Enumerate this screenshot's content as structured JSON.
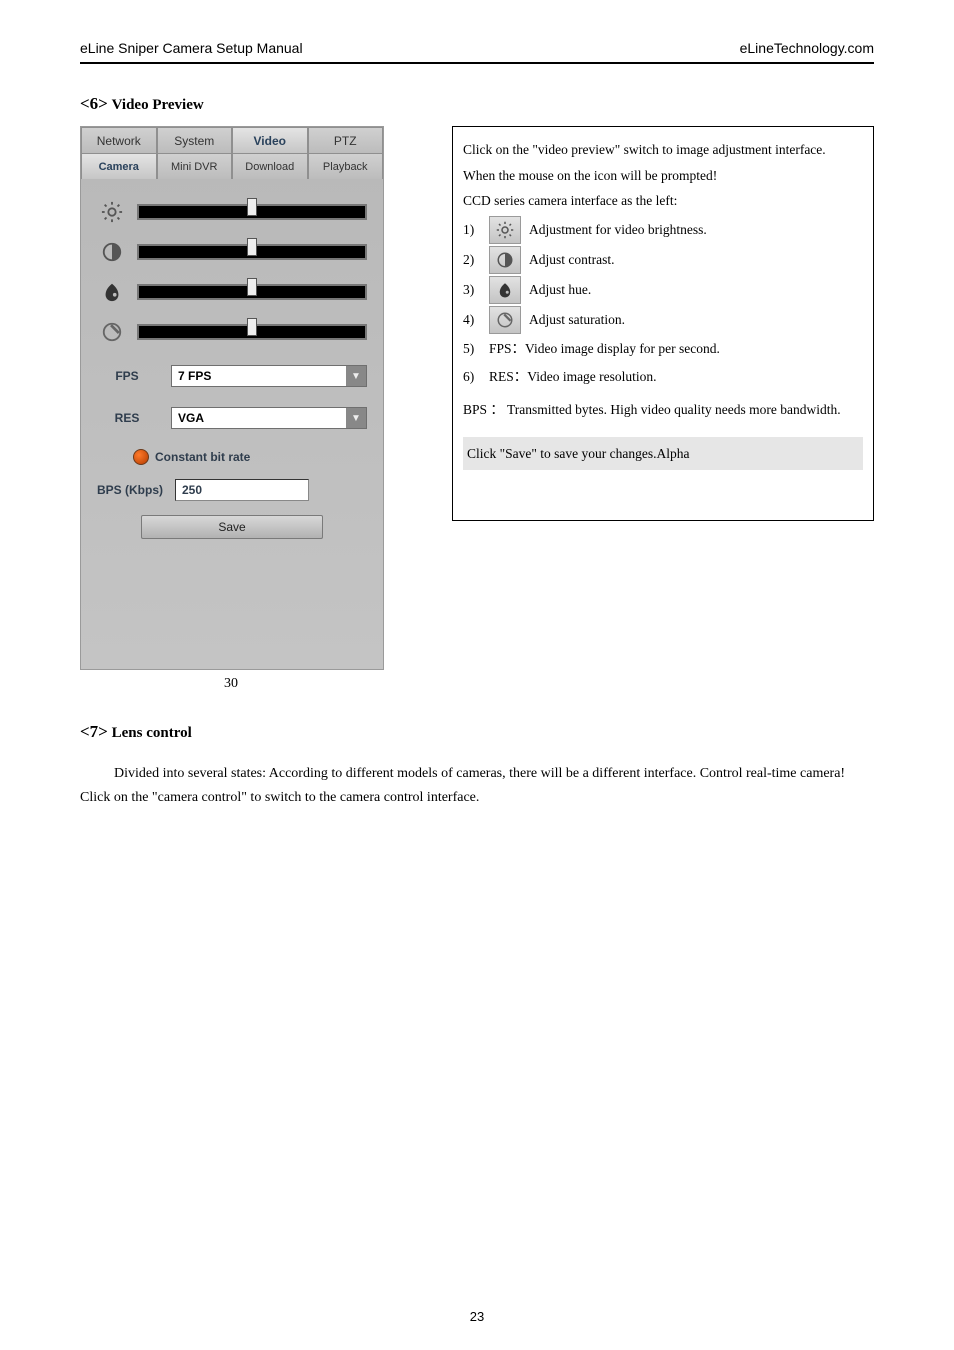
{
  "header": {
    "left": "eLine Sniper Camera Setup Manual",
    "right": "eLineTechnology.com"
  },
  "section6": {
    "angle": "<6>",
    "title": "Video Preview"
  },
  "screenshot": {
    "top_tabs": {
      "network": "Network",
      "system": "System",
      "video": "Video",
      "ptz": "PTZ"
    },
    "sub_tabs": {
      "camera": "Camera",
      "minidvr": "Mini DVR",
      "download": "Download",
      "playback": "Playback"
    },
    "fps_label": "FPS",
    "fps_value": "7 FPS",
    "res_label": "RES",
    "res_value": "VGA",
    "constant_bit_rate": "Constant bit rate",
    "bps_label": "BPS (Kbps)",
    "bps_value": "250",
    "save": "Save",
    "caption": "30"
  },
  "callout": {
    "p1": "Click on the \"video preview\" switch to image adjustment interface.",
    "p2": "When the mouse on the icon will be prompted!",
    "p3": "CCD series camera interface as the left:",
    "items": {
      "i1": {
        "n": "1)",
        "t": "Adjustment for video brightness."
      },
      "i2": {
        "n": "2)",
        "t": "Adjust contrast."
      },
      "i3": {
        "n": "3)",
        "t": "Adjust hue."
      },
      "i4": {
        "n": "4)",
        "t": "Adjust saturation."
      },
      "i5": {
        "n": "5)",
        "t": "FPS：Video image display for per second."
      },
      "i6": {
        "n": "6)",
        "t": "RES：Video image resolution."
      }
    },
    "bps": "BPS ： Transmitted bytes. High video quality needs more bandwidth.",
    "save_note": "Click \"Save\" to save your changes.Alpha"
  },
  "section7": {
    "angle": "<7>",
    "title": "Lens control"
  },
  "body7": "Divided into several states: According to different models of cameras, there will be a different interface. Control real-time camera! Click on the \"camera control\" to switch to the camera control interface.",
  "page_number": "23"
}
